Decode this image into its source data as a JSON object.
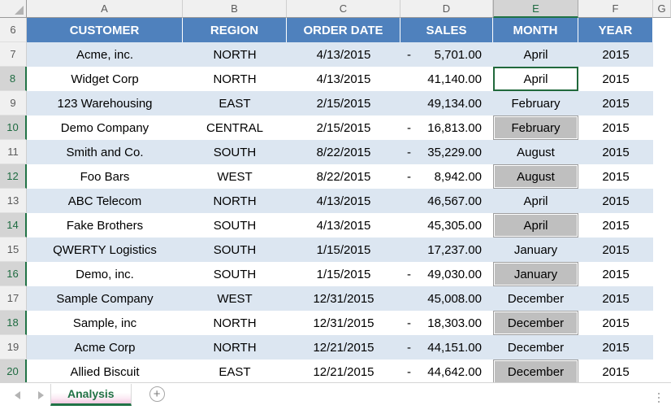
{
  "app": {
    "select_all_icon": "select-all-triangle",
    "add_sheet_icon": "plus-circle-icon",
    "nav_prev_icon": "triangle-left-icon",
    "nav_next_icon": "triangle-right-icon"
  },
  "colors": {
    "table_header_fill": "#4F81BD",
    "band_fill": "#DCE6F1",
    "highlight_fill": "#BFBFBF",
    "active_cell_border": "#21693C",
    "sheet_tab_accent": "#217346"
  },
  "columns": {
    "letters": [
      "A",
      "B",
      "C",
      "D",
      "E",
      "F",
      "G"
    ],
    "active_letter": "E"
  },
  "table": {
    "header_row_number": "6",
    "headers": [
      "CUSTOMER",
      "REGION",
      "ORDER DATE",
      "SALES",
      "MONTH",
      "YEAR"
    ],
    "rows": [
      {
        "num": "7",
        "highlighted": false,
        "customer": "Acme, inc.",
        "region": "NORTH",
        "order_date": "4/13/2015",
        "sales": "5,701.00",
        "sales_negative": true,
        "month": "April",
        "month_flagged": false,
        "year": "2015"
      },
      {
        "num": "8",
        "highlighted": true,
        "customer": "Widget Corp",
        "region": "NORTH",
        "order_date": "4/13/2015",
        "sales": "41,140.00",
        "sales_negative": false,
        "month": "April",
        "month_flagged": false,
        "year": "2015",
        "active": true
      },
      {
        "num": "9",
        "highlighted": false,
        "customer": "123 Warehousing",
        "region": "EAST",
        "order_date": "2/15/2015",
        "sales": "49,134.00",
        "sales_negative": false,
        "month": "February",
        "month_flagged": false,
        "year": "2015"
      },
      {
        "num": "10",
        "highlighted": true,
        "customer": "Demo Company",
        "region": "CENTRAL",
        "order_date": "2/15/2015",
        "sales": "16,813.00",
        "sales_negative": true,
        "month": "February",
        "month_flagged": true,
        "year": "2015"
      },
      {
        "num": "11",
        "highlighted": false,
        "customer": "Smith and Co.",
        "region": "SOUTH",
        "order_date": "8/22/2015",
        "sales": "35,229.00",
        "sales_negative": true,
        "month": "August",
        "month_flagged": false,
        "year": "2015"
      },
      {
        "num": "12",
        "highlighted": true,
        "customer": "Foo Bars",
        "region": "WEST",
        "order_date": "8/22/2015",
        "sales": "8,942.00",
        "sales_negative": true,
        "month": "August",
        "month_flagged": true,
        "year": "2015"
      },
      {
        "num": "13",
        "highlighted": false,
        "customer": "ABC Telecom",
        "region": "NORTH",
        "order_date": "4/13/2015",
        "sales": "46,567.00",
        "sales_negative": false,
        "month": "April",
        "month_flagged": false,
        "year": "2015"
      },
      {
        "num": "14",
        "highlighted": true,
        "customer": "Fake Brothers",
        "region": "SOUTH",
        "order_date": "4/13/2015",
        "sales": "45,305.00",
        "sales_negative": false,
        "month": "April",
        "month_flagged": true,
        "year": "2015"
      },
      {
        "num": "15",
        "highlighted": false,
        "customer": "QWERTY Logistics",
        "region": "SOUTH",
        "order_date": "1/15/2015",
        "sales": "17,237.00",
        "sales_negative": false,
        "month": "January",
        "month_flagged": false,
        "year": "2015"
      },
      {
        "num": "16",
        "highlighted": true,
        "customer": "Demo, inc.",
        "region": "SOUTH",
        "order_date": "1/15/2015",
        "sales": "49,030.00",
        "sales_negative": true,
        "month": "January",
        "month_flagged": true,
        "year": "2015"
      },
      {
        "num": "17",
        "highlighted": false,
        "customer": "Sample Company",
        "region": "WEST",
        "order_date": "12/31/2015",
        "sales": "45,008.00",
        "sales_negative": false,
        "month": "December",
        "month_flagged": false,
        "year": "2015"
      },
      {
        "num": "18",
        "highlighted": true,
        "customer": "Sample, inc",
        "region": "NORTH",
        "order_date": "12/31/2015",
        "sales": "18,303.00",
        "sales_negative": true,
        "month": "December",
        "month_flagged": true,
        "year": "2015"
      },
      {
        "num": "19",
        "highlighted": false,
        "customer": "Acme Corp",
        "region": "NORTH",
        "order_date": "12/21/2015",
        "sales": "44,151.00",
        "sales_negative": true,
        "month": "December",
        "month_flagged": false,
        "year": "2015"
      },
      {
        "num": "20",
        "highlighted": true,
        "customer": "Allied Biscuit",
        "region": "EAST",
        "order_date": "12/21/2015",
        "sales": "44,642.00",
        "sales_negative": true,
        "month": "December",
        "month_flagged": true,
        "year": "2015"
      }
    ]
  },
  "sheet_tabs": {
    "tabs": [
      {
        "name": "Analysis",
        "active": true
      }
    ],
    "add_label": "+"
  },
  "negative_sign": "-"
}
